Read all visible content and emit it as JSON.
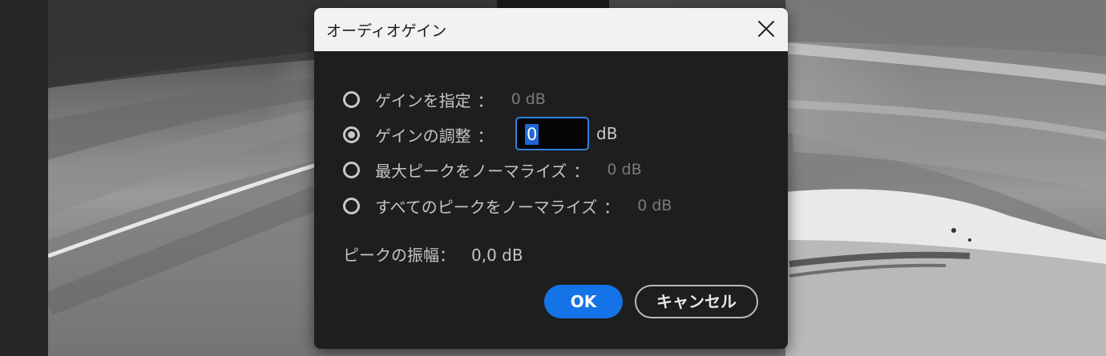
{
  "dialog": {
    "title": "オーディオゲイン",
    "options": [
      {
        "label": "ゲインを指定",
        "colon": "：",
        "value": "0 dB",
        "checked": false
      },
      {
        "label": "ゲインの調整",
        "colon": "：",
        "value": "",
        "checked": true
      },
      {
        "label": "最大ピークをノーマライズ",
        "colon": "：",
        "value": "0 dB",
        "checked": false
      },
      {
        "label": "すべてのピークをノーマライズ",
        "colon": "：",
        "value": "0 dB",
        "checked": false
      }
    ],
    "gain_input": {
      "value": "0",
      "unit": "dB"
    },
    "peak_amplitude": {
      "label": "ピークの振幅：",
      "value": "0,0 dB"
    },
    "buttons": {
      "ok": "OK",
      "cancel": "キャンセル"
    }
  },
  "colors": {
    "dialog_bg": "#1e1e1e",
    "titlebar_bg": "#f3f1f1",
    "accent": "#1473e6",
    "focus_border": "#2f7fe0"
  },
  "icons": {
    "close": "close-icon",
    "radio": "radio-icon"
  }
}
